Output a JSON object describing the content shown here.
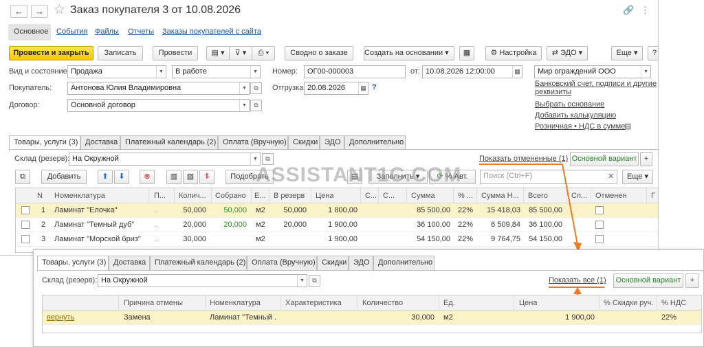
{
  "window": {
    "title": "Заказ покупателя 3 от 10.08.2026"
  },
  "nav": {
    "back": "←",
    "forward": "→"
  },
  "subnav": [
    "Основное",
    "События",
    "Файлы",
    "Отчеты",
    "Заказы покупателей с сайта"
  ],
  "toolbar": {
    "post_close": "Провести и закрыть",
    "save": "Записать",
    "post": "Провести",
    "summary": "Сводно о заказе",
    "create_based": "Создать на основании",
    "settings": "Настройка",
    "edo": "ЭДО",
    "more": "Еще",
    "help": "?"
  },
  "form": {
    "status_label": "Вид и состояние:",
    "type_value": "Продажа",
    "state_value": "В работе",
    "number_label": "Номер:",
    "number_value": "ОГ00-000003",
    "date_label": "от:",
    "date_value": "10.08.2026 12:00:00",
    "org_value": "Мир ограждений ООО",
    "buyer_label": "Покупатель:",
    "buyer_value": "Антонова Юлия Владимировна",
    "ship_label": "Отгрузка:",
    "ship_value": "20.08.2026",
    "ship_help": "?",
    "contract_label": "Договор:",
    "contract_value": "Основной договор"
  },
  "right_links": {
    "bank_line1": "Банковский счет, подписи и другие",
    "bank_line2": "реквизиты",
    "choose_basis": "Выбрать основание",
    "add_calc": "Добавить калькуляцию",
    "vat": "Розничная • НДС в сумме"
  },
  "tabs": [
    "Товары, услуги (3)",
    "Доставка",
    "Платежный календарь (2)",
    "Оплата (Вручную)",
    "Скидки",
    "ЭДО",
    "Дополнительно"
  ],
  "warehouse": {
    "label": "Склад (резерв):",
    "value": "На Окружной"
  },
  "show_cancelled": "Показать отмененные (1)",
  "main_variant": "Основной вариант",
  "plus": "+",
  "table_toolbar": {
    "add": "Добавить",
    "pick": "Подобрать",
    "fill": "Заполнить",
    "auto_pct": "% Авт.",
    "search_placeholder": "Поиск (Ctrl+F)",
    "more": "Еще"
  },
  "table": {
    "headers": [
      "N",
      "Номенклатура",
      "П...",
      "Колич...",
      "Собрано",
      "Е...",
      "В резерв",
      "Цена",
      "С...",
      "С...",
      "Сумма",
      "% ...",
      "Сумма Н...",
      "Всего",
      "Сп...",
      "Отменен",
      "Г"
    ],
    "rows": [
      {
        "n": "1",
        "name": "Ламинат \"Елочка\"",
        "dots": "..",
        "qty": "50,000",
        "collected": "50,000",
        "unit": "м2",
        "reserve": "50,000",
        "price": "1 800,00",
        "sum": "85 500,00",
        "pct": "22%",
        "vat": "15 418,03",
        "total": "85 500,00"
      },
      {
        "n": "2",
        "name": "Ламинат \"Темный дуб\"",
        "dots": "..",
        "qty": "20,000",
        "collected": "20,000",
        "unit": "м2",
        "reserve": "20,000",
        "price": "1 900,00",
        "sum": "36 100,00",
        "pct": "22%",
        "vat": "6 509,84",
        "total": "36 100,00"
      },
      {
        "n": "3",
        "name": "Ламинат \"Морской бриз\"",
        "dots": "..",
        "qty": "30,000",
        "collected": "",
        "unit": "м2",
        "reserve": "",
        "price": "1 900,00",
        "sum": "54 150,00",
        "pct": "22%",
        "vat": "9 764,75",
        "total": "54 150,00"
      }
    ]
  },
  "watermark": "ASSISTANT1C.COM",
  "overlay": {
    "warehouse_label": "Склад (резерв):",
    "warehouse_value": "На Окружной",
    "show_all": "Показать все (1)",
    "main_variant": "Основной вариант",
    "plus": "+",
    "headers": [
      "Причина отмены",
      "Номенклатура",
      "Характеристика",
      "Количество",
      "Ед.",
      "Цена",
      "% Скидки руч.",
      "% НДС"
    ],
    "row": {
      "action": "вернуть",
      "reason": "Замена",
      "name": "Ламинат \"Темный ...",
      "qty": "30,000",
      "unit": "м2",
      "price": "1 900,00",
      "vat": "22%"
    }
  },
  "colors": {
    "accent_yellow": "#f5c800",
    "link_blue": "#1a4f9c",
    "highlight_row": "#fbf3c8",
    "arrow_orange": "#ec7a26",
    "green_text": "#2e8b2e"
  }
}
